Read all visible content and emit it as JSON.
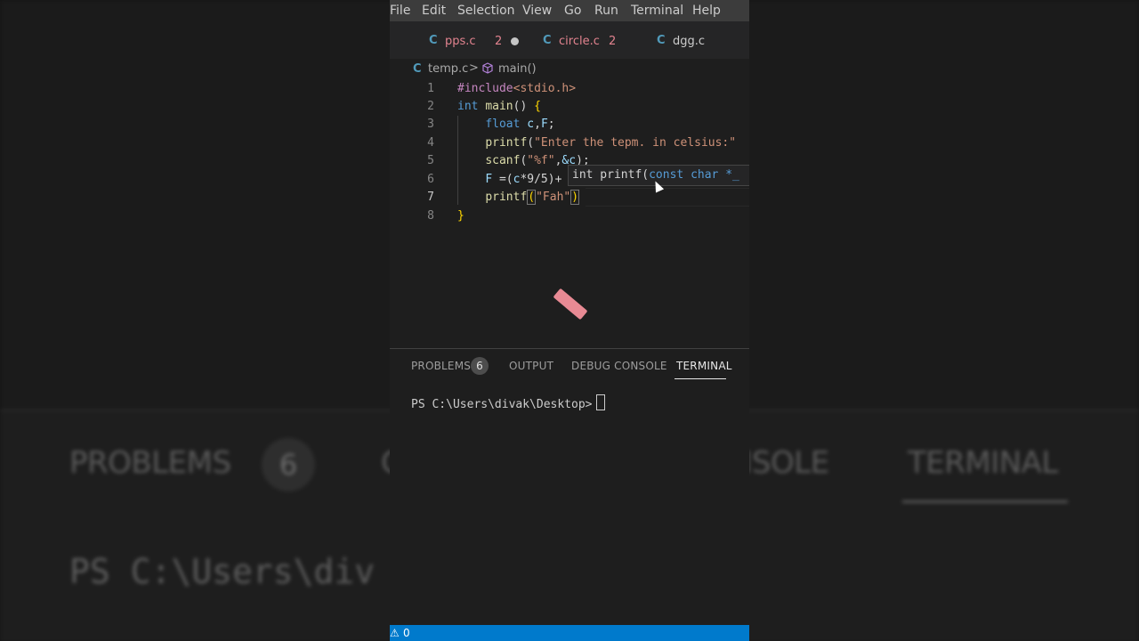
{
  "background": {
    "tabs": [
      "PROBLEMS",
      "C",
      "NSOLE",
      "TERMINAL"
    ],
    "problems_count": "6",
    "terminal_line": "PS C:\\Users\\div"
  },
  "menubar": [
    "File",
    "Edit",
    "Selection",
    "View",
    "Go",
    "Run",
    "Terminal",
    "Help"
  ],
  "tabs": [
    {
      "icon": "C",
      "name": "pps.c",
      "count": "2",
      "modified": true
    },
    {
      "icon": "C",
      "name": "circle.c",
      "count": "2",
      "modified": false
    },
    {
      "icon": "C",
      "name": "dgg.c",
      "count": "",
      "modified": false
    }
  ],
  "breadcrumb": {
    "icon": "C",
    "file": "temp.c",
    "separator": ">",
    "symbol": "main()"
  },
  "editor": {
    "line_numbers": [
      "1",
      "2",
      "3",
      "4",
      "5",
      "6",
      "7",
      "8"
    ],
    "active_line": 7,
    "hover_hint": {
      "prefix": "int printf(",
      "keyword1": "const",
      "keyword2": "char",
      "rest": " *_"
    }
  },
  "panel": {
    "tabs": [
      "PROBLEMS",
      "OUTPUT",
      "DEBUG CONSOLE",
      "TERMINAL"
    ],
    "problems_count": "6",
    "active_tab": "TERMINAL",
    "terminal_prompt": "PS C:\\Users\\divak\\Desktop>"
  },
  "statusbar": {
    "warning_icon": "⚠",
    "warning_count": "0"
  },
  "colors": {
    "accent": "#007acc",
    "badge_red": "#e2838f",
    "menubar": "#3c3c3c"
  }
}
